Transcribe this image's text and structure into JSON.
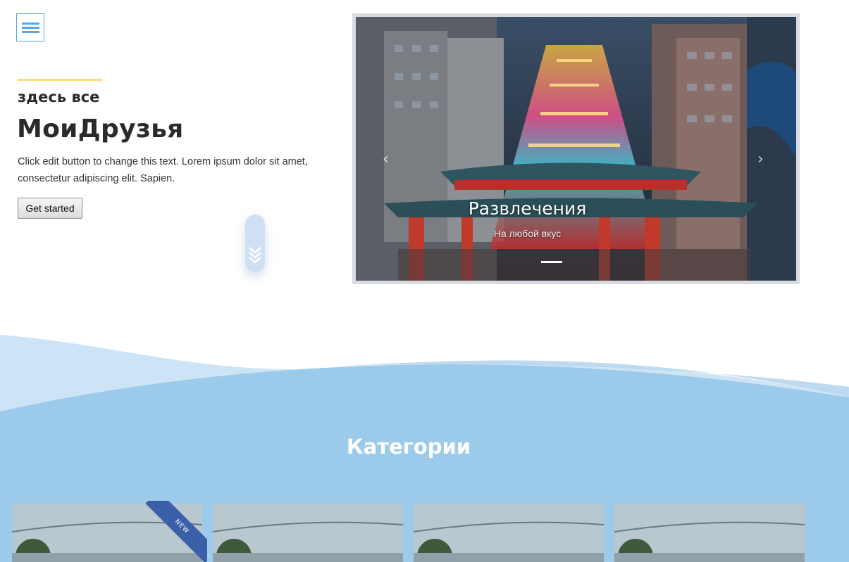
{
  "hero": {
    "subtitle": "здесь все",
    "title": "МоиДрузья",
    "lead": "Click edit button to change this text. Lorem ipsum dolor sit amet, consectetur adipiscing elit. Sapien.",
    "cta_label": "Get started"
  },
  "slider": {
    "prev_glyph": "‹",
    "next_glyph": "›",
    "caption_title": "Развлечения",
    "caption_subtitle": "На любой вкус",
    "indicator_count": 1,
    "active_indicator": 0
  },
  "categories": {
    "title": "Категории",
    "cards": [
      {
        "badge": "NEW"
      },
      {
        "badge": ""
      },
      {
        "badge": ""
      },
      {
        "badge": ""
      }
    ]
  },
  "colors": {
    "accent_line": "#ffdb7a",
    "menu_blue": "#5aa6e0",
    "band_blue": "#9ccaeb",
    "ribbon_blue": "#3b5ea8"
  },
  "icons": {
    "menu": "hamburger-icon",
    "scroll": "double-chevron-down-icon",
    "prev": "chevron-left-icon",
    "next": "chevron-right-icon"
  }
}
